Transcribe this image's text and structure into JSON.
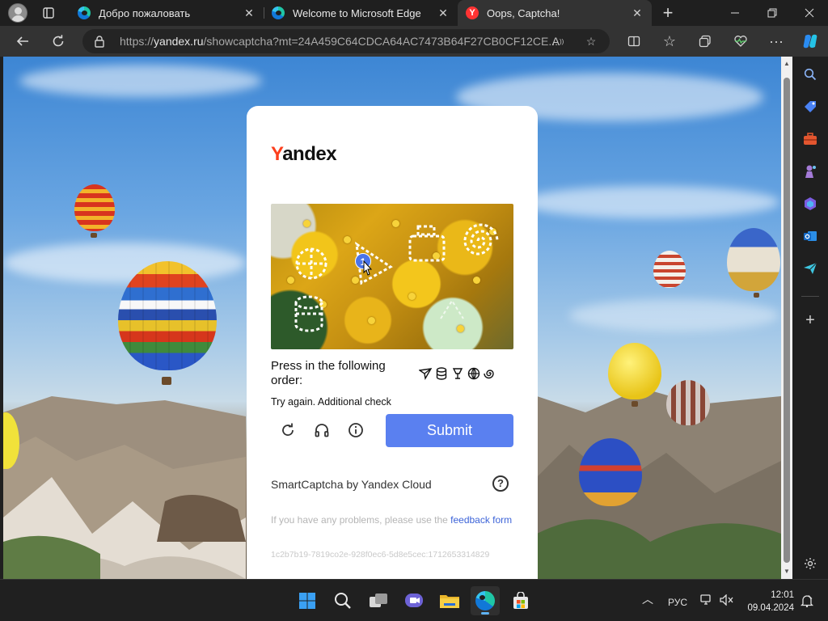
{
  "browser": {
    "tabs": [
      {
        "title": "Добро пожаловать",
        "favicon": "edge-icon",
        "active": false
      },
      {
        "title": "Welcome to Microsoft Edge",
        "favicon": "edge-icon",
        "active": false
      },
      {
        "title": "Oops, Captcha!",
        "favicon": "yandex-icon",
        "active": true
      }
    ],
    "url_prefix": "https://",
    "url_host": "yandex.ru",
    "url_rest": "/showcaptcha?mt=24A459C64CDCA64AC7473B64F27CB0CF12CE..."
  },
  "captcha": {
    "logo_first": "Y",
    "logo_rest": "andex",
    "click_marker": "1",
    "order_text": "Press in the following order:",
    "order_icons": [
      "paper-plane-icon",
      "barrel-icon",
      "lamp-icon",
      "globe-icon",
      "spiral-icon"
    ],
    "retry_text": "Try again. Additional check",
    "controls": [
      "refresh-icon",
      "headphones-icon",
      "info-icon"
    ],
    "submit_label": "Submit",
    "brand_line": "SmartCaptcha by Yandex Cloud",
    "help_label": "?",
    "problems_text": "If you have any problems, please use the ",
    "problems_link": "feedback form",
    "token": "1c2b7b19-7819co2e-928f0ec6-5d8e5cec:1712653314829"
  },
  "taskbar": {
    "language": "РУС",
    "time": "12:01",
    "date": "09.04.2024"
  },
  "colors": {
    "submit": "#5a80f0",
    "yandex_red": "#fc3f1d",
    "link": "#3d64d8"
  }
}
